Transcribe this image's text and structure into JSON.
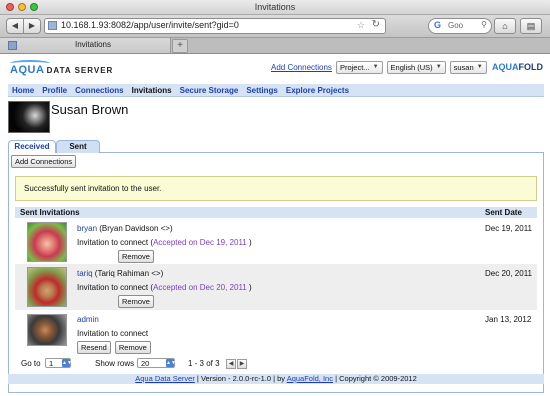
{
  "window": {
    "title": "Invitations"
  },
  "browser": {
    "url": "10.168.1.93:8082/app/user/invite/sent?gid=0",
    "search_placeholder": "Goo",
    "tab_label": "Invitations"
  },
  "header": {
    "logo_aqua": "AQUA",
    "logo_rest": "DATA SERVER",
    "logo_right": "AQUAFOLD",
    "add_connections_link": "Add Connections",
    "project_select": "Project...",
    "language_select": "English (US)",
    "user_select": "susan"
  },
  "nav": {
    "items": [
      "Home",
      "Profile",
      "Connections",
      "Invitations",
      "Secure Storage",
      "Settings",
      "Explore Projects"
    ],
    "active": "Invitations"
  },
  "profile": {
    "name": "Susan Brown"
  },
  "tabs": {
    "received": "Received",
    "sent": "Sent"
  },
  "actions": {
    "add_connections_button": "Add Connections"
  },
  "notice": "Successfully sent invitation to the user.",
  "table": {
    "headers": {
      "invitations": "Sent Invitations",
      "date": "Sent Date"
    },
    "rows": [
      {
        "user": "bryan",
        "detail": "(Bryan Davidson <>)",
        "message": "Invitation to connect",
        "status_pre": "(",
        "status": "Accepted on Dec 19, 2011",
        "status_post": ")",
        "buttons": [
          "Remove"
        ],
        "date": "Dec 19, 2011"
      },
      {
        "user": "tariq",
        "detail": "(Tariq Rahiman <>)",
        "message": "Invitation to connect",
        "status_pre": "(",
        "status": "Accepted on Dec 20, 2011",
        "status_post": ")",
        "buttons": [
          "Remove"
        ],
        "date": "Dec 20, 2011"
      },
      {
        "user": "admin",
        "detail": "",
        "message": "Invitation to connect",
        "status_pre": "",
        "status": "",
        "status_post": "",
        "buttons": [
          "Resend",
          "Remove"
        ],
        "date": "Jan 13, 2012"
      }
    ]
  },
  "pager": {
    "goto_label": "Go to",
    "goto_value": "1",
    "rows_label": "Show rows",
    "rows_value": "20",
    "range": "1 - 3 of 3"
  },
  "footer": {
    "link1": "Aqua Data Server",
    "middle": " | Version - 2.0.0-rc-1.0 | by ",
    "link2": "AquaFold, Inc",
    "end": " | Copyright © 2009-2012"
  },
  "colors": {
    "accent": "#1b3fb6",
    "nav_bg": "#d6e3f5",
    "notice_bg": "#fbfbd6",
    "accepted": "#7a3fc0"
  }
}
